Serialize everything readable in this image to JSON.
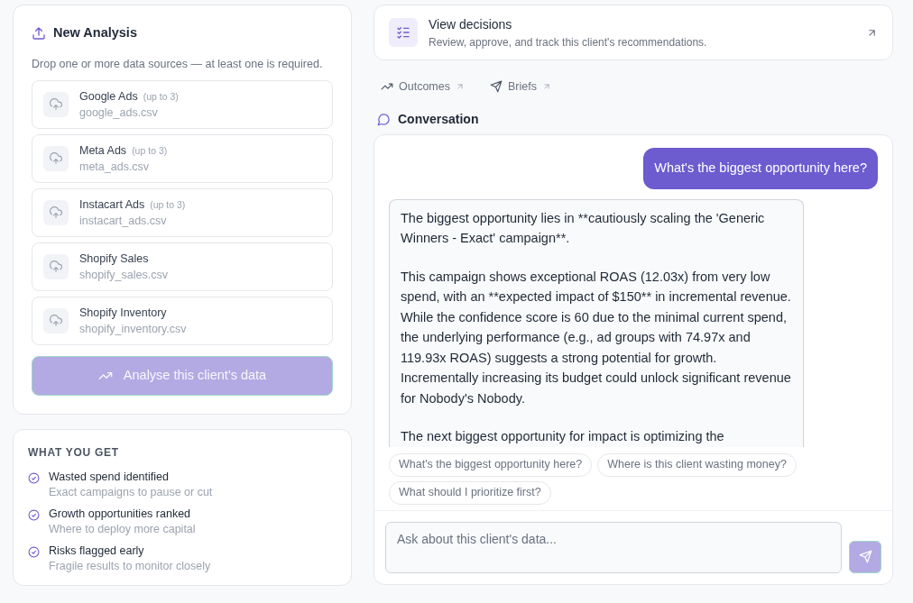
{
  "new_analysis": {
    "title": "New Analysis",
    "description": "Drop one or more data sources — at least one is required.",
    "sources": [
      {
        "name": "Google Ads",
        "limit": "(up to 3)",
        "file": "google_ads.csv"
      },
      {
        "name": "Meta Ads",
        "limit": "(up to 3)",
        "file": "meta_ads.csv"
      },
      {
        "name": "Instacart Ads",
        "limit": "(up to 3)",
        "file": "instacart_ads.csv"
      },
      {
        "name": "Shopify Sales",
        "file": "shopify_sales.csv"
      },
      {
        "name": "Shopify Inventory",
        "file": "shopify_inventory.csv"
      }
    ],
    "button": {
      "label": "Analyse this client's data",
      "disabled": true
    }
  },
  "what_you_get": {
    "title": "WHAT YOU GET",
    "items": [
      {
        "title": "Wasted spend identified",
        "detail": "Exact campaigns to pause or cut"
      },
      {
        "title": "Growth opportunities ranked",
        "detail": "Where to deploy more capital"
      },
      {
        "title": "Risks flagged early",
        "detail": "Fragile results to monitor closely"
      }
    ]
  },
  "decisions": {
    "title": "View decisions",
    "subtitle": "Review, approve, and track this client's recommendations."
  },
  "links": [
    {
      "kind": "outcomes",
      "label": "Outcomes"
    },
    {
      "kind": "briefs",
      "label": "Briefs"
    }
  ],
  "conversation": {
    "title": "Conversation",
    "messages": [
      {
        "kind": "user",
        "paragraphs": [
          "What's the biggest opportunity here?"
        ]
      },
      {
        "kind": "assistant",
        "paragraphs": [
          "The biggest opportunity lies in **cautiously scaling the 'Generic Winners - Exact' campaign**.",
          "This campaign shows exceptional ROAS (12.03x) from very low spend, with an **expected impact of $150** in incremental revenue. While the confidence score is 60 due to the minimal current spend, the underlying performance (e.g., ad groups with 74.97x and 119.93x ROAS) suggests a strong potential for growth. Incrementally increasing its budget could unlock significant revenue for Nobody's Nobody.",
          "The next biggest opportunity for impact is optimizing the"
        ]
      }
    ],
    "suggestions": [
      "What's the biggest opportunity here?",
      "Where is this client wasting money?",
      "What should I prioritize first?"
    ],
    "input": {
      "placeholder": "Ask about this client's data..."
    },
    "send": {
      "disabled": true
    }
  }
}
